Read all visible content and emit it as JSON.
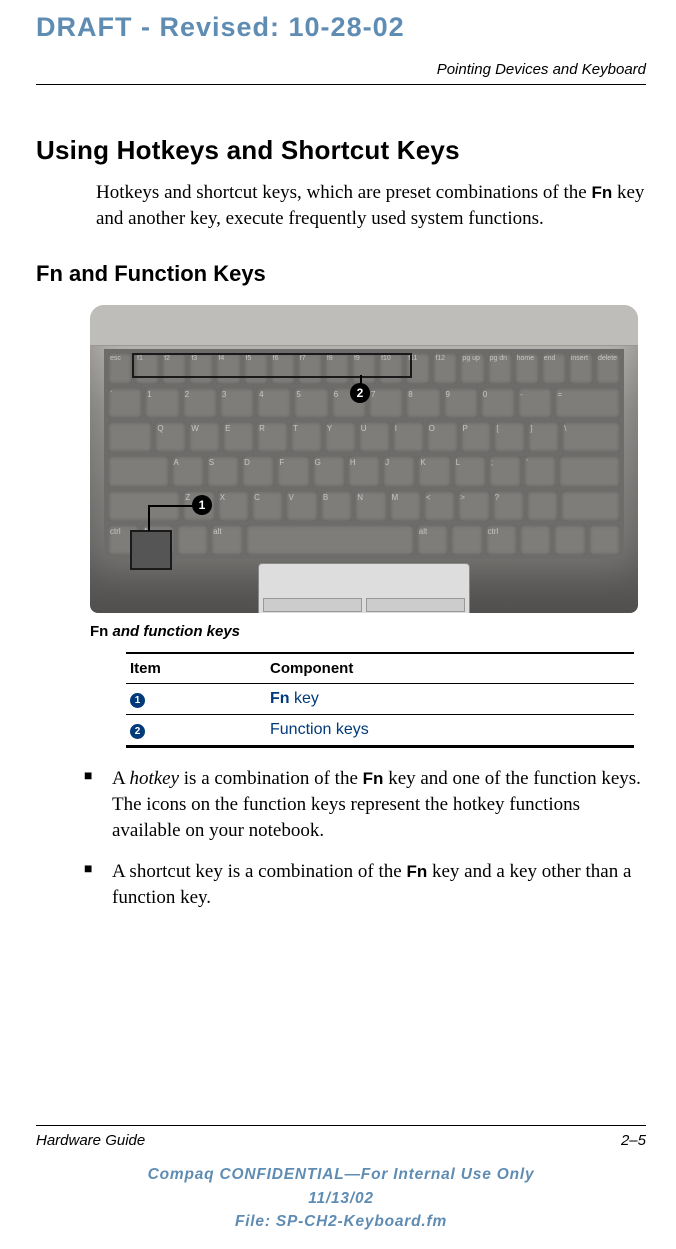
{
  "watermark": "DRAFT - Revised: 10-28-02",
  "chapter_title": "Pointing Devices and Keyboard",
  "h1": "Using Hotkeys and Shortcut Keys",
  "intro_line1": "Hotkeys and shortcut keys, which are preset combinations of the ",
  "intro_fn": "Fn",
  "intro_line2": " key and another key, execute frequently used system functions.",
  "h2": "Fn and Function Keys",
  "figure": {
    "caption_fn": "Fn",
    "caption_rest": " and function keys",
    "callouts": {
      "c1": "1",
      "c2": "2"
    }
  },
  "table": {
    "head_item": "Item",
    "head_component": "Component",
    "rows": [
      {
        "num": "1",
        "comp_prefix": "Fn",
        "comp_rest": " key"
      },
      {
        "num": "2",
        "comp_prefix": "",
        "comp_rest": "Function keys"
      }
    ]
  },
  "bullets": [
    {
      "pre": "A ",
      "ital": "hotkey",
      "mid": " is a combination of the ",
      "fn": "Fn",
      "post": " key and one of the function keys. The icons on the function keys represent the hotkey functions available on your notebook."
    },
    {
      "pre": "A shortcut key is a combination of the ",
      "ital": "",
      "mid": "",
      "fn": "Fn",
      "post": " key and a key other than a function key."
    }
  ],
  "footer": {
    "left": "Hardware Guide",
    "right": "2–5",
    "conf1": "Compaq CONFIDENTIAL—For Internal Use Only",
    "conf2": "11/13/02",
    "conf3": "File: SP-CH2-Keyboard.fm"
  },
  "kbd_rows": [
    [
      "esc",
      "f1",
      "f2",
      "f3",
      "f4",
      "f5",
      "f6",
      "f7",
      "f8",
      "f9",
      "f10",
      "f11",
      "f12",
      "pg up",
      "pg dn",
      "home",
      "end",
      "insert",
      "delete"
    ],
    [
      "`",
      "1",
      "2",
      "3",
      "4",
      "5",
      "6",
      "7",
      "8",
      "9",
      "0",
      "-",
      "="
    ],
    [
      "",
      "Q",
      "W",
      "E",
      "R",
      "T",
      "Y",
      "U",
      "I",
      "O",
      "P",
      "[",
      "]",
      "\\"
    ],
    [
      "",
      "A",
      "S",
      "D",
      "F",
      "G",
      "H",
      "J",
      "K",
      "L",
      ";",
      "'",
      ""
    ],
    [
      "",
      "Z",
      "X",
      "C",
      "V",
      "B",
      "N",
      "M",
      "<",
      ">",
      "?",
      "",
      ""
    ],
    [
      "ctrl",
      "fn",
      "",
      "alt",
      "",
      "alt",
      "",
      "ctrl",
      "",
      "",
      ""
    ]
  ]
}
